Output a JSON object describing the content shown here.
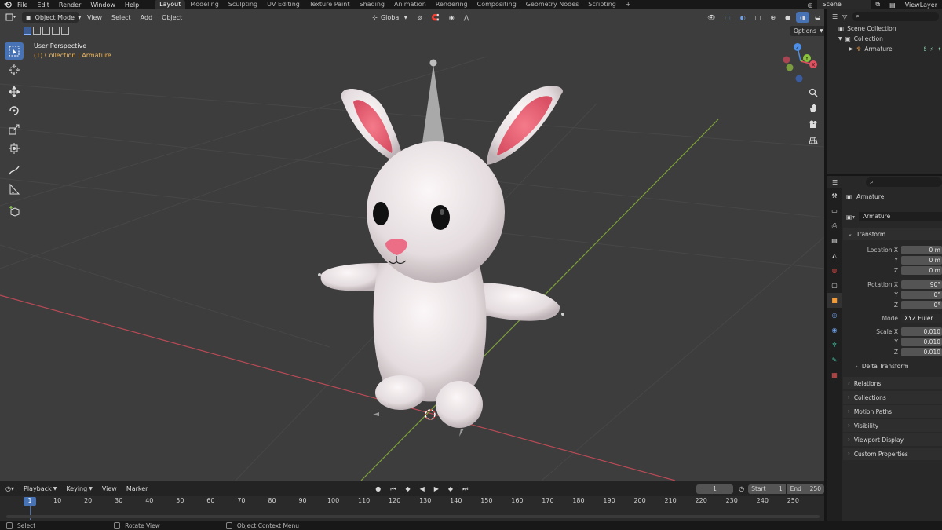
{
  "topbar": {
    "menus": [
      "File",
      "Edit",
      "Render",
      "Window",
      "Help"
    ],
    "workspaces": [
      "Layout",
      "Modeling",
      "Sculpting",
      "UV Editing",
      "Texture Paint",
      "Shading",
      "Animation",
      "Rendering",
      "Compositing",
      "Geometry Nodes",
      "Scripting"
    ],
    "active_workspace": "Layout",
    "add_workspace": "+",
    "scene_label": "Scene",
    "view_layer_label": "ViewLayer"
  },
  "viewport_header": {
    "mode": "Object Mode",
    "menus": [
      "View",
      "Select",
      "Add",
      "Object"
    ],
    "orientation": "Global",
    "options_label": "Options"
  },
  "viewport": {
    "perspective_label": "User Perspective",
    "collection_label": "(1) Collection | ",
    "object_label": "Armature"
  },
  "outliner": {
    "root": "Scene Collection",
    "collection": "Collection",
    "object": "Armature"
  },
  "properties": {
    "object_name": "Armature",
    "data_name": "Armature",
    "transform_label": "Transform",
    "location_label": "Location X",
    "y_label": "Y",
    "z_label": "Z",
    "location": [
      "0 m",
      "0 m",
      "0 m"
    ],
    "rotation_label": "Rotation X",
    "rotation": [
      "90°",
      "0°",
      "0°"
    ],
    "mode_label": "Mode",
    "mode_value": "XYZ Euler",
    "scale_label": "Scale X",
    "scale": [
      "0.010",
      "0.010",
      "0.010"
    ],
    "delta_label": "Delta Transform",
    "sections": [
      "Relations",
      "Collections",
      "Motion Paths",
      "Visibility",
      "Viewport Display",
      "Custom Properties"
    ]
  },
  "timeline": {
    "menus": [
      "Playback",
      "Keying",
      "View",
      "Marker"
    ],
    "current_frame": "1",
    "start_label": "Start",
    "start_value": "1",
    "end_label": "End",
    "end_value": "250",
    "ticks": [
      "1",
      "10",
      "20",
      "30",
      "40",
      "50",
      "60",
      "70",
      "80",
      "90",
      "100",
      "110",
      "120",
      "130",
      "140",
      "150",
      "160",
      "170",
      "180",
      "190",
      "200",
      "210",
      "220",
      "230",
      "240",
      "250"
    ]
  },
  "statusbar": {
    "items": [
      "Select",
      "Rotate View",
      "Object Context Menu"
    ]
  },
  "colors": {
    "accent": "#4772b3",
    "viewport_bg": "#3d3d3d",
    "object_label": "#f0b65a",
    "x_axis": "#b84a55",
    "y_axis": "#7da13a"
  }
}
